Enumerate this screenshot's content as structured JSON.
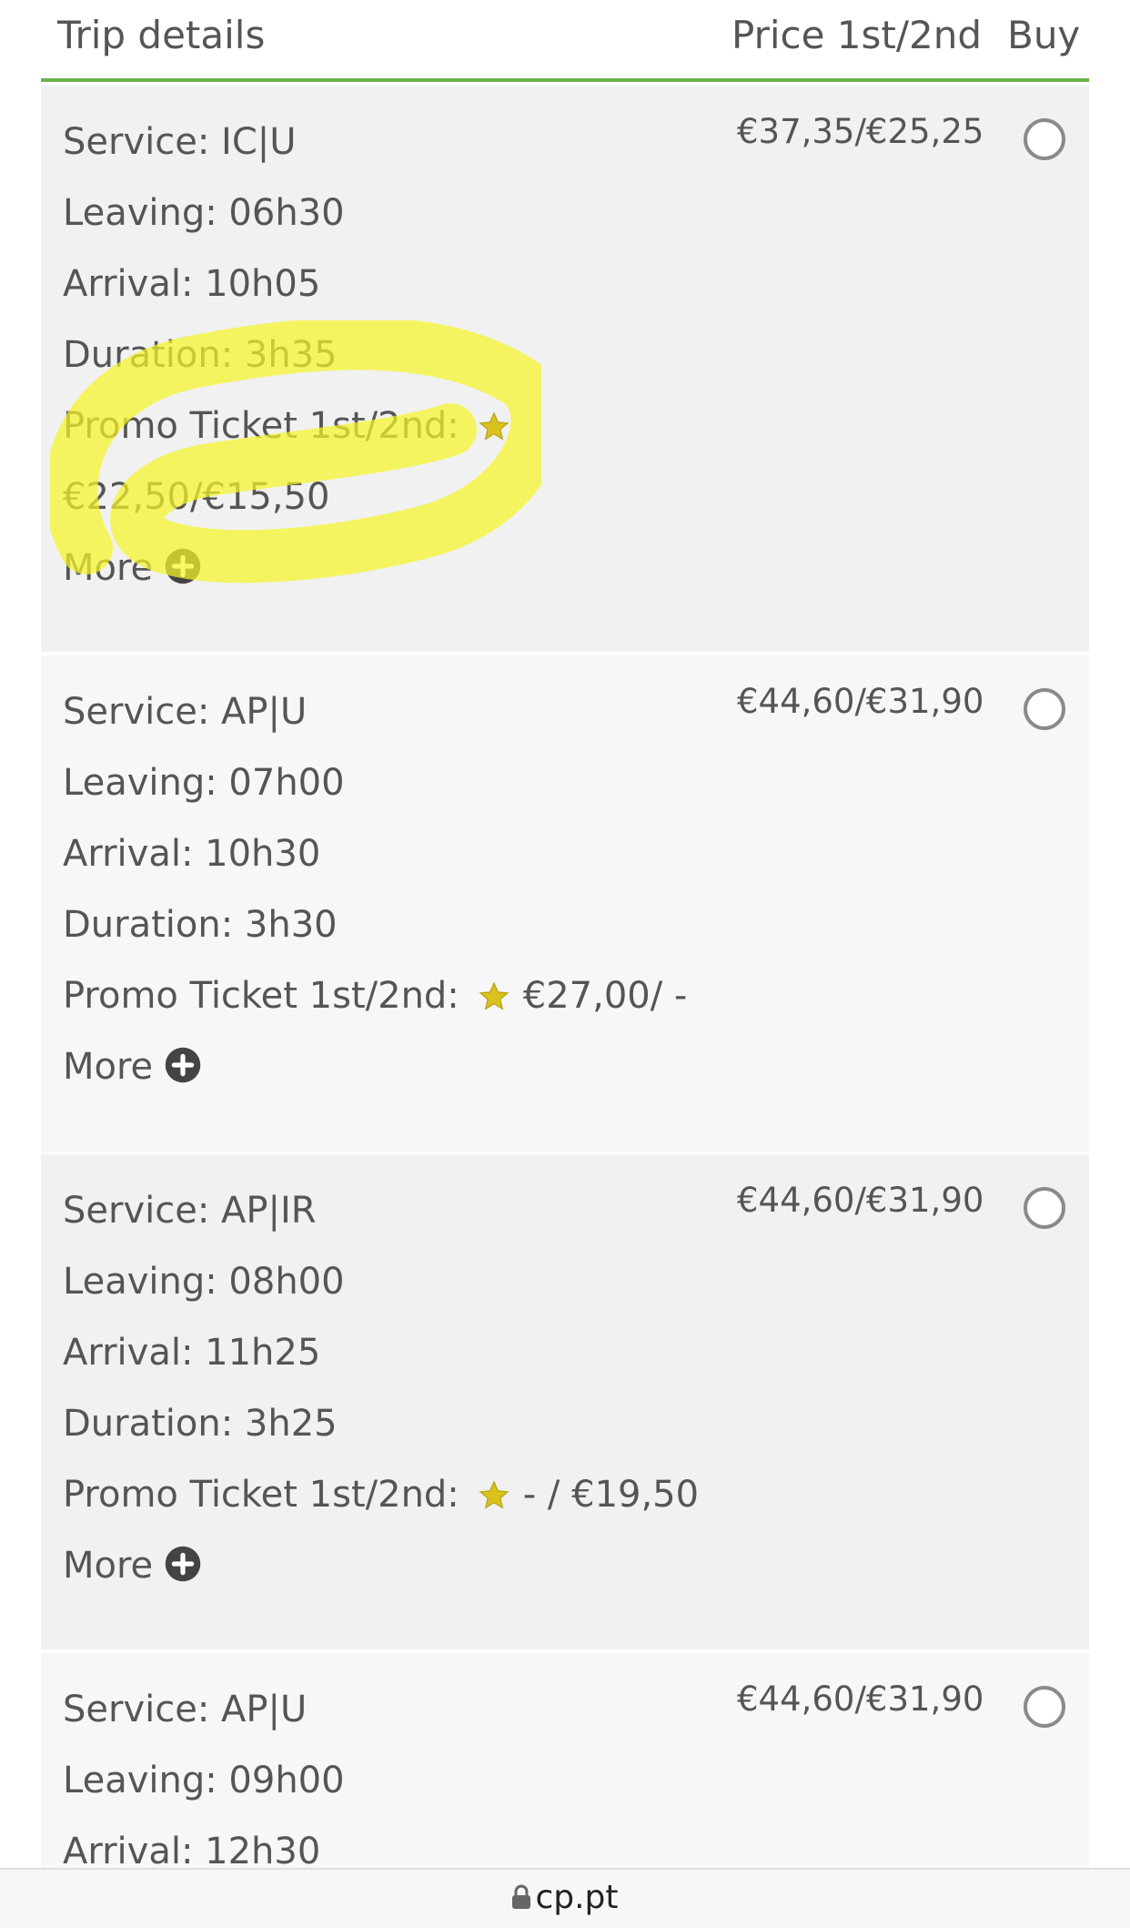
{
  "header": {
    "trip_details": "Trip details",
    "price": "Price 1st/2nd",
    "buy": "Buy"
  },
  "trips": [
    {
      "service": "Service: IC|U",
      "leaving": "Leaving: 06h30",
      "arrival": "Arrival: 10h05",
      "duration": "Duration: 3h35",
      "promo_label": "Promo Ticket 1st/2nd:",
      "promo_value": "€22,50/€15,50",
      "more": "More",
      "price": "€37,35/€25,25"
    },
    {
      "service": "Service: AP|U",
      "leaving": "Leaving: 07h00",
      "arrival": "Arrival: 10h30",
      "duration": "Duration: 3h30",
      "promo_label": "Promo Ticket 1st/2nd:",
      "promo_value": "€27,00/ -",
      "more": "More",
      "price": "€44,60/€31,90"
    },
    {
      "service": "Service: AP|IR",
      "leaving": "Leaving: 08h00",
      "arrival": "Arrival: 11h25",
      "duration": "Duration: 3h25",
      "promo_label": "Promo Ticket 1st/2nd:",
      "promo_value": "- / €19,50",
      "more": "More",
      "price": "€44,60/€31,90"
    },
    {
      "service": "Service: AP|U",
      "leaving": "Leaving: 09h00",
      "arrival": "Arrival: 12h30",
      "price": "€44,60/€31,90"
    }
  ],
  "url_bar": {
    "domain": "cp.pt"
  },
  "colors": {
    "accent_line": "#6ab04c",
    "star": "#d9c21e",
    "highlight": "#f5f52a"
  }
}
